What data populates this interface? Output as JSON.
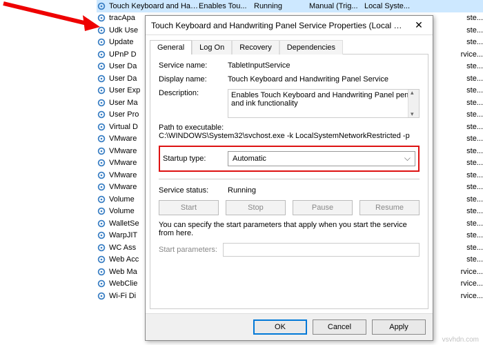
{
  "services": [
    {
      "name": "Touch Keyboard and Hand...",
      "desc": "Enables Tou...",
      "status": "Running",
      "startup": "Manual (Trig...",
      "logon": "Local Syste..."
    },
    {
      "name": "tracApa",
      "tail": "ste..."
    },
    {
      "name": "Udk Use",
      "tail": "ste..."
    },
    {
      "name": "Update",
      "tail": "ste..."
    },
    {
      "name": "UPnP D",
      "tail": "rvice..."
    },
    {
      "name": "User Da",
      "tail": "ste..."
    },
    {
      "name": "User Da",
      "tail": "ste..."
    },
    {
      "name": "User Exp",
      "tail": "ste..."
    },
    {
      "name": "User Ma",
      "tail": "ste..."
    },
    {
      "name": "User Pro",
      "tail": "ste..."
    },
    {
      "name": "Virtual D",
      "tail": "ste..."
    },
    {
      "name": "VMware",
      "tail": "ste..."
    },
    {
      "name": "VMware",
      "tail": "ste..."
    },
    {
      "name": "VMware",
      "tail": "ste..."
    },
    {
      "name": "VMware",
      "tail": "ste..."
    },
    {
      "name": "VMware",
      "tail": "ste..."
    },
    {
      "name": "Volume",
      "tail": "ste..."
    },
    {
      "name": "Volume",
      "tail": "ste..."
    },
    {
      "name": "WalletSe",
      "tail": "ste..."
    },
    {
      "name": "WarpJIT",
      "tail": "ste..."
    },
    {
      "name": "WC Ass",
      "tail": "ste..."
    },
    {
      "name": "Web Acc",
      "tail": "ste..."
    },
    {
      "name": "Web Ma",
      "tail": "rvice..."
    },
    {
      "name": "WebClie",
      "tail": "rvice..."
    },
    {
      "name": "Wi-Fi Di",
      "tail": "rvice..."
    }
  ],
  "dialog": {
    "title": "Touch Keyboard and Handwriting Panel Service Properties (Local C...",
    "tabs": {
      "general": "General",
      "logon": "Log On",
      "recovery": "Recovery",
      "deps": "Dependencies"
    },
    "service_name_label": "Service name:",
    "service_name_value": "TabletInputService",
    "display_name_label": "Display name:",
    "display_name_value": "Touch Keyboard and Handwriting Panel Service",
    "description_label": "Description:",
    "description_value": "Enables Touch Keyboard and Handwriting Panel pen and ink functionality",
    "path_label": "Path to executable:",
    "path_value": "C:\\WINDOWS\\System32\\svchost.exe -k LocalSystemNetworkRestricted -p",
    "startup_type_label": "Startup type:",
    "startup_type_value": "Automatic",
    "status_label": "Service status:",
    "status_value": "Running",
    "buttons": {
      "start": "Start",
      "stop": "Stop",
      "pause": "Pause",
      "resume": "Resume"
    },
    "hint": "You can specify the start parameters that apply when you start the service from here.",
    "params_label": "Start parameters:",
    "footer": {
      "ok": "OK",
      "cancel": "Cancel",
      "apply": "Apply"
    }
  },
  "watermark": "vsvhdn.com"
}
